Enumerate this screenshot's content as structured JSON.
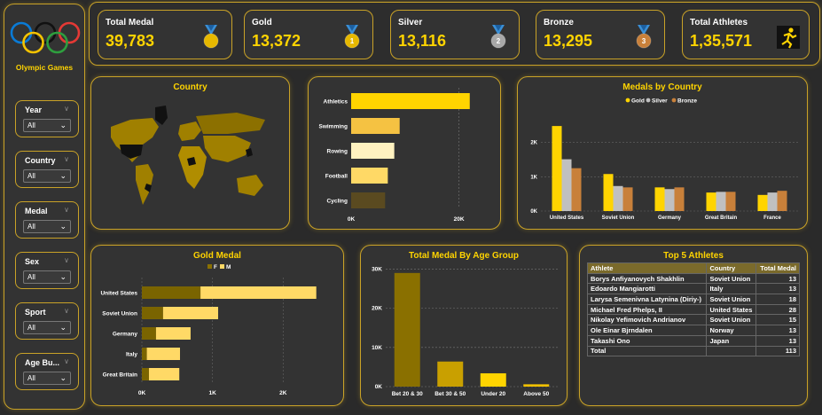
{
  "sidebar": {
    "logo_label": "Olympic Games",
    "filters": [
      {
        "title": "Year",
        "value": "All"
      },
      {
        "title": "Country",
        "value": "All"
      },
      {
        "title": "Medal",
        "value": "All"
      },
      {
        "title": "Sex",
        "value": "All"
      },
      {
        "title": "Sport",
        "value": "All"
      },
      {
        "title": "Age Bu...",
        "value": "All"
      }
    ]
  },
  "kpis": [
    {
      "label": "Total Medal",
      "value": "39,783",
      "icon": "medal-gold-icon"
    },
    {
      "label": "Gold",
      "value": "13,372",
      "icon": "medal-1-icon"
    },
    {
      "label": "Silver",
      "value": "13,116",
      "icon": "medal-2-icon"
    },
    {
      "label": "Bronze",
      "value": "13,295",
      "icon": "medal-3-icon"
    },
    {
      "label": "Total Athletes",
      "value": "1,35,571",
      "icon": "runner-icon"
    }
  ],
  "colors": {
    "gold": "#ffd400",
    "silver": "#c0c0c0",
    "bronze": "#c8803a",
    "accent": "#c9a227",
    "female": "#7a6400",
    "male": "#ffd966"
  },
  "country_map": {
    "title": "Country"
  },
  "sport_chart": {
    "chart_data": {
      "type": "bar",
      "orientation": "horizontal",
      "categories": [
        "Athletics",
        "Swimming",
        "Rowing",
        "Football",
        "Cycling"
      ],
      "values": [
        22000,
        9000,
        8000,
        6800,
        6300
      ],
      "xlim": [
        0,
        25000
      ],
      "ticks": [
        "0K",
        "20K"
      ]
    }
  },
  "medals_by_country": {
    "title": "Medals by Country",
    "legend": [
      "Gold",
      "Silver",
      "Bronze"
    ],
    "chart_data": {
      "type": "bar",
      "categories": [
        "United States",
        "Soviet Union",
        "Germany",
        "Great Britain",
        "France"
      ],
      "series": [
        {
          "name": "Gold",
          "values": [
            2480,
            1080,
            690,
            540,
            470
          ]
        },
        {
          "name": "Silver",
          "values": [
            1510,
            730,
            640,
            560,
            540
          ]
        },
        {
          "name": "Bronze",
          "values": [
            1250,
            690,
            690,
            560,
            590
          ]
        }
      ],
      "ylim": [
        0,
        3000
      ],
      "ticks": [
        "0K",
        "1K",
        "2K"
      ]
    }
  },
  "gold_medal": {
    "title": "Gold Medal",
    "legend": [
      "F",
      "M"
    ],
    "chart_data": {
      "type": "bar",
      "orientation": "horizontal",
      "stacked": true,
      "categories": [
        "United States",
        "Soviet Union",
        "Germany",
        "Italy",
        "Great Britain"
      ],
      "series": [
        {
          "name": "F",
          "values": [
            830,
            300,
            200,
            70,
            100
          ]
        },
        {
          "name": "M",
          "values": [
            1640,
            780,
            490,
            470,
            430
          ]
        }
      ],
      "xlim": [
        0,
        2700
      ],
      "ticks": [
        "0K",
        "1K",
        "2K"
      ]
    }
  },
  "age_group": {
    "title": "Total Medal By Age Group",
    "chart_data": {
      "type": "bar",
      "categories": [
        "Bet 20 & 30",
        "Bet 30 & 50",
        "Under 20",
        "Above 50"
      ],
      "values": [
        29000,
        6400,
        3400,
        600
      ],
      "ylim": [
        0,
        31000
      ],
      "ticks": [
        "0K",
        "10K",
        "20K",
        "30K"
      ],
      "colors": [
        "#8a7000",
        "#c9a000",
        "#ffd400",
        "#f0c000"
      ]
    }
  },
  "top5": {
    "title": "Top 5 Athletes",
    "columns": [
      "Athlete",
      "Country",
      "Total Medal"
    ],
    "rows": [
      [
        "Borys Anfiyanovych Shakhlin",
        "Soviet Union",
        "13"
      ],
      [
        "Edoardo Mangiarotti",
        "Italy",
        "13"
      ],
      [
        "Larysa Semenivna Latynina (Diriy-)",
        "Soviet Union",
        "18"
      ],
      [
        "Michael Fred Phelps, II",
        "United States",
        "28"
      ],
      [
        "Nikolay Yefimovich Andrianov",
        "Soviet Union",
        "15"
      ],
      [
        "Ole Einar Bjrndalen",
        "Norway",
        "13"
      ],
      [
        "Takashi Ono",
        "Japan",
        "13"
      ]
    ],
    "total_label": "Total",
    "total_value": "113"
  }
}
